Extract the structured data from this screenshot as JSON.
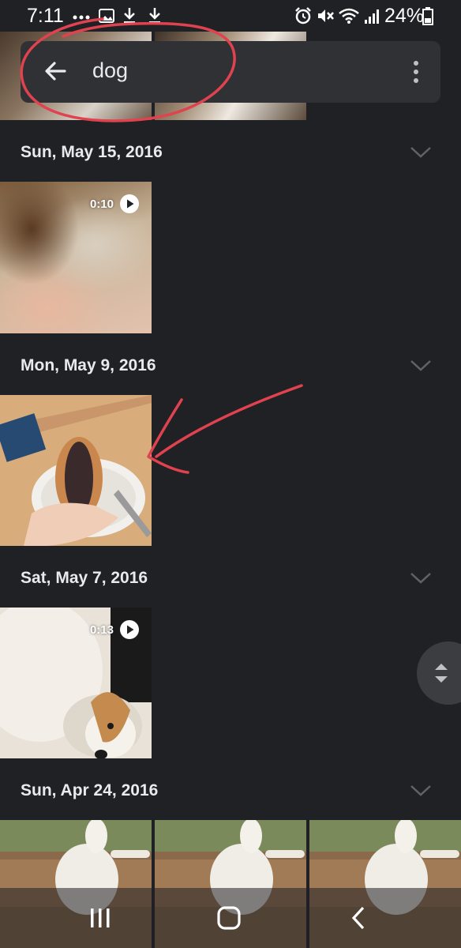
{
  "status_bar": {
    "time": "7:11",
    "battery_percent": "24%",
    "left_icons": [
      "more-dots-icon",
      "image-icon",
      "download-icon",
      "download-icon"
    ],
    "right_icons": [
      "alarm-icon",
      "mute-icon",
      "wifi-icon",
      "signal-icon",
      "battery-icon"
    ]
  },
  "search": {
    "query": "dog",
    "back_icon": "arrow-left-icon",
    "menu_icon": "more-vert-icon"
  },
  "groups": [
    {
      "date": "Sun, May 15, 2016",
      "items": [
        {
          "kind": "video",
          "duration": "0:10"
        }
      ]
    },
    {
      "date": "Mon, May 9, 2016",
      "items": [
        {
          "kind": "photo"
        }
      ]
    },
    {
      "date": "Sat, May 7, 2016",
      "items": [
        {
          "kind": "video",
          "duration": "0:13"
        }
      ]
    },
    {
      "date": "Sun, Apr 24, 2016",
      "items": [
        {
          "kind": "photo"
        },
        {
          "kind": "photo"
        },
        {
          "kind": "photo"
        }
      ]
    }
  ],
  "annotations": {
    "circle_color": "#e0424f",
    "arrow_color": "#e0424f"
  },
  "colors": {
    "background": "#202124",
    "search_bar": "#303134",
    "text": "#e8eaed"
  }
}
